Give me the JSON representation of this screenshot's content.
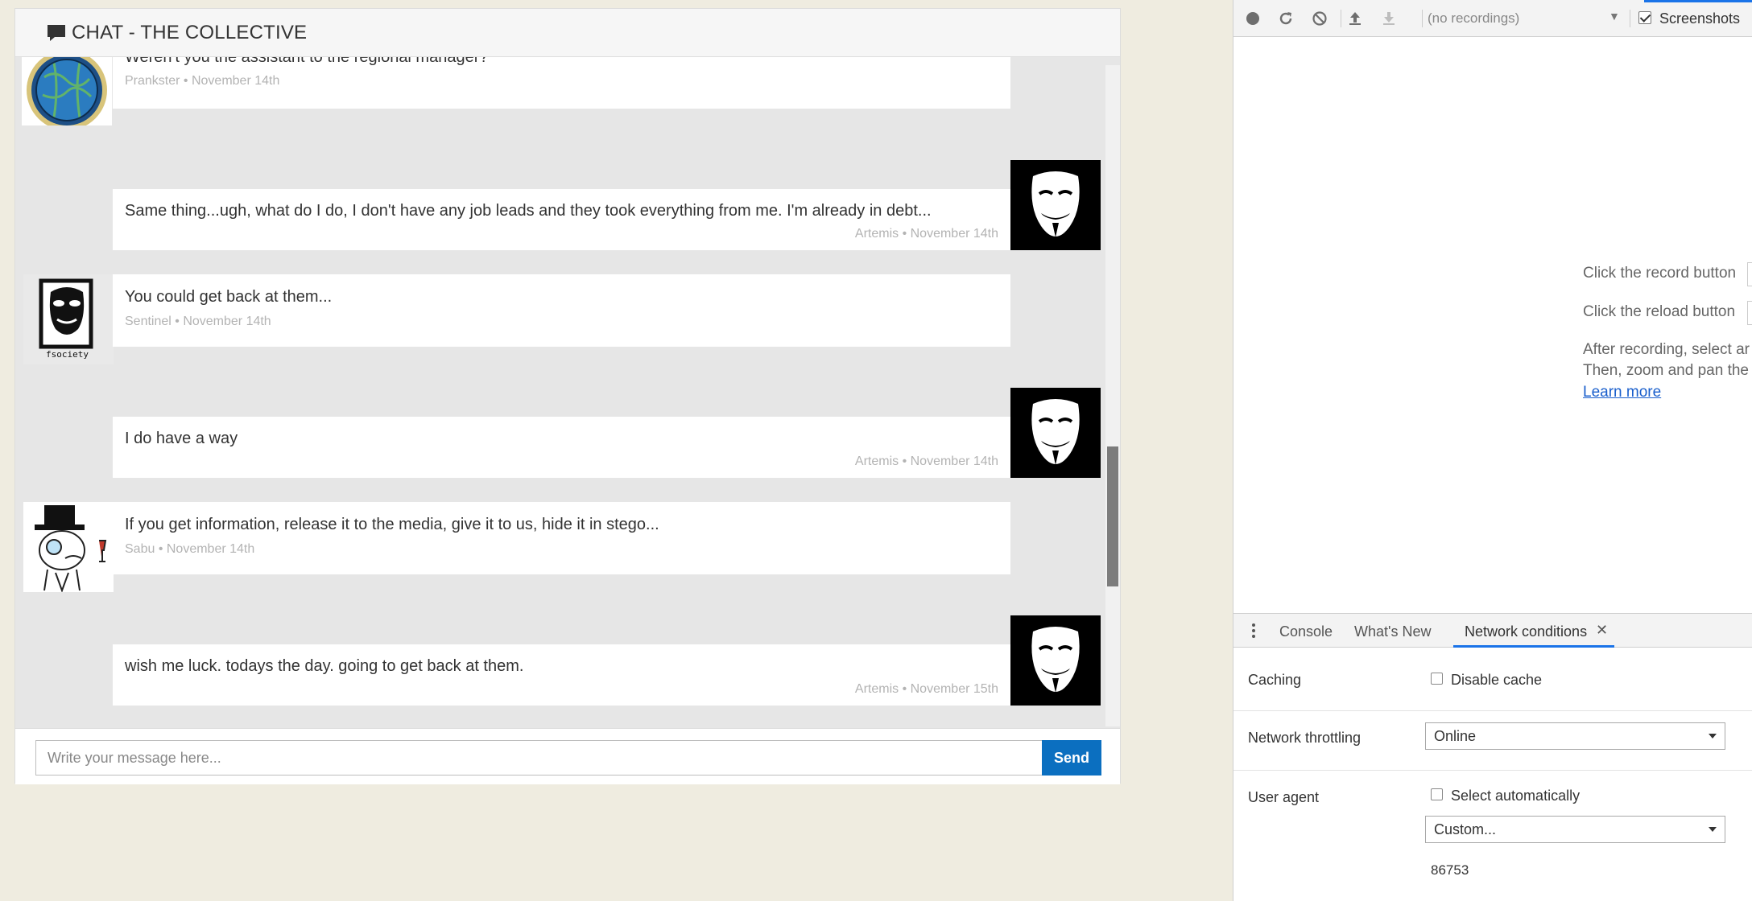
{
  "chat": {
    "title": "CHAT - THE COLLECTIVE",
    "input_placeholder": "Write your message here...",
    "send_label": "Send",
    "messages": [
      {
        "text": "Weren't you the assistant to the regional manager?",
        "meta": "Prankster • November 14th",
        "side": "left",
        "avatar": "globe-avatar"
      },
      {
        "text": "Same thing...ugh, what do I do, I don't have any job leads and they took everything from me. I'm already in debt...",
        "meta": "Artemis • November 14th",
        "side": "right",
        "avatar": "guy-fawkes-mask-avatar"
      },
      {
        "text": "You could get back at them...",
        "meta": "Sentinel • November 14th",
        "side": "left",
        "avatar": "fsociety-mask-avatar"
      },
      {
        "text": "I do have a way",
        "meta": "Artemis • November 14th",
        "side": "right",
        "avatar": "guy-fawkes-mask-avatar"
      },
      {
        "text": "If you get information, release it to the media, give it to us, hide it in stego...",
        "meta": "Sabu • November 14th",
        "side": "left",
        "avatar": "monocle-meme-avatar"
      },
      {
        "text": "wish me luck. todays the day. going to get back at them.",
        "meta": "Artemis • November 15th",
        "side": "right",
        "avatar": "guy-fawkes-mask-avatar"
      }
    ],
    "fsociety_text": "fsociety"
  },
  "devtools": {
    "recordings_placeholder": "(no recordings)",
    "screenshots_label": "Screenshots",
    "hints": {
      "record": "Click the record button",
      "reload": "Click the reload button",
      "after1": "After recording, select ar",
      "after2": "Then, zoom and pan the",
      "learn_more": "Learn more"
    },
    "drawer_tabs": {
      "console": "Console",
      "whats_new": "What's New",
      "network_conditions": "Network conditions",
      "close": "✕"
    },
    "network_conditions": {
      "caching_label": "Caching",
      "disable_cache_label": "Disable cache",
      "throttling_label": "Network throttling",
      "throttling_value": "Online",
      "user_agent_label": "User agent",
      "select_auto_label": "Select automatically",
      "ua_select_value": "Custom...",
      "ua_value": "86753"
    }
  },
  "colors": {
    "page_bg": "#efece0",
    "chat_body_bg": "#e6e6e6",
    "send_button": "#0b6fc0",
    "devtools_accent": "#1a73e8",
    "link": "#1a5fcc"
  }
}
